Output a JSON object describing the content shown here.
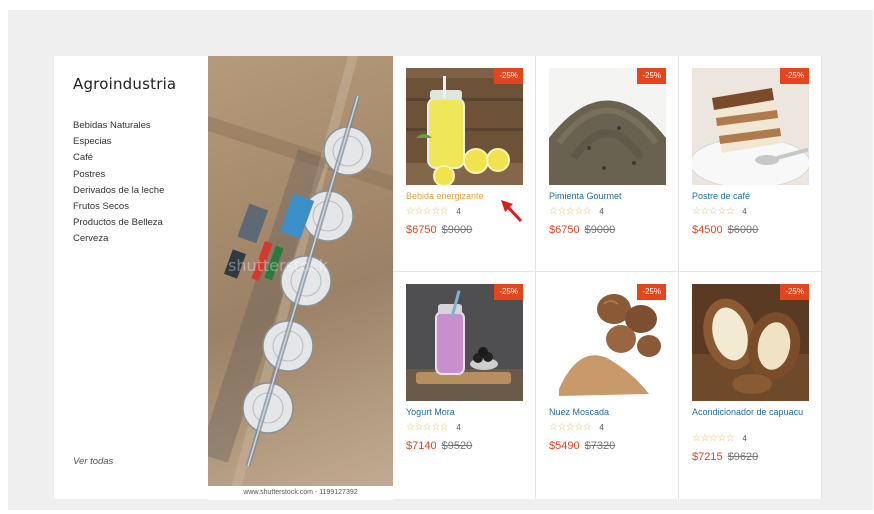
{
  "sidebar": {
    "title": "Agroindustria",
    "categories": [
      "Bebidas Naturales",
      "Especias",
      "Café",
      "Postres",
      "Derivados de la leche",
      "Frutos Secos",
      "Productos de Belleza",
      "Cerveza"
    ],
    "see_all": "Ver todas"
  },
  "hero": {
    "credit": "www.shutterstock.com - 1199127392",
    "watermark": "shutterstock"
  },
  "products": [
    {
      "name": "Bebida energizante",
      "badge": "-25%",
      "rating_count": "4",
      "price": "$6750",
      "old_price": "$9000",
      "stars": "☆☆☆☆☆"
    },
    {
      "name": "Pimienta Gourmet",
      "badge": "-25%",
      "rating_count": "4",
      "price": "$6750",
      "old_price": "$9000",
      "stars": "☆☆☆☆☆"
    },
    {
      "name": "Postre de café",
      "badge": "-25%",
      "rating_count": "4",
      "price": "$4500",
      "old_price": "$6000",
      "stars": "☆☆☆☆☆"
    },
    {
      "name": "Yogurt Mora",
      "badge": "-25%",
      "rating_count": "4",
      "price": "$7140",
      "old_price": "$9520",
      "stars": "☆☆☆☆☆"
    },
    {
      "name": "Nuez Moscada",
      "badge": "-25%",
      "rating_count": "4",
      "price": "$5490",
      "old_price": "$7320",
      "stars": "☆☆☆☆☆"
    },
    {
      "name": "Acondicionador de capuacu",
      "badge": "-25%",
      "rating_count": "4",
      "price": "$7215",
      "old_price": "$9620",
      "stars": "☆☆☆☆☆"
    }
  ],
  "colors": {
    "badge": "#e5451c",
    "price": "#e04622",
    "link": "#1d6fa5",
    "hover": "#e8a33a",
    "arrow": "#e01b1b"
  }
}
